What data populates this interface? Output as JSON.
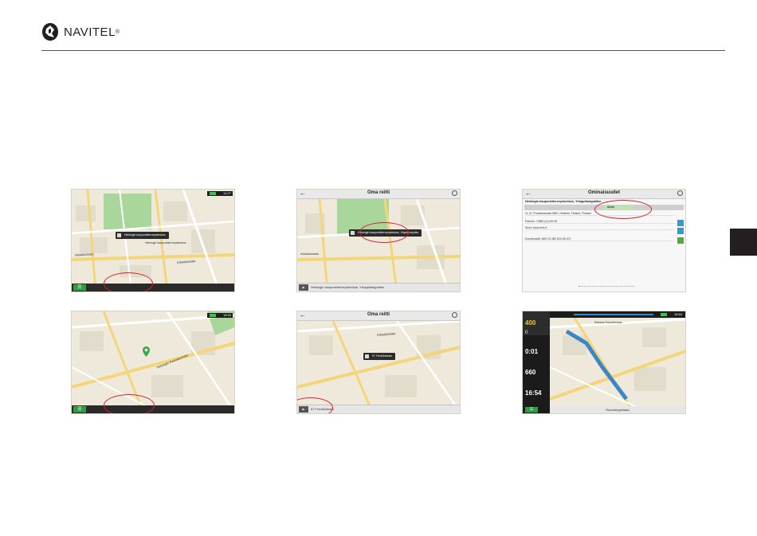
{
  "brand": {
    "name": "NAVITEL",
    "reg": "®"
  },
  "shots": {
    "s1": {
      "time": "14:27",
      "popup": "Helsingin kaupunkiterveyskeskus",
      "label_a": "Helsingin kaupunkiterveyskeskus",
      "street1": "Arkadiankatu",
      "street2": "Arkadiankatu"
    },
    "s2": {
      "title": "Oma reitti",
      "popup": "Helsingin kaupunkiterveyskeskus, Vlopistonpolku",
      "route": "Helsingin kaupunkiterveyskeskus, Ylioppilastypäiten",
      "street1": "Arkadiankatu"
    },
    "s3": {
      "title": "Ominaisuudet",
      "header": "Helsingin kaupunkiterveyskeskus, Ylioppilastypäiten",
      "go": "Aloita",
      "row1": "11 10, Pursilantaraita 0810, Helsinki, Finland, Finland",
      "row2": "Puhelin: +3580 (0) 000 00",
      "row3": "Sivut: www.hels.fi",
      "row4": "Koordinaatit: N60 10.380  E24 55.471"
    },
    "s4": {
      "time": "16:53",
      "street1": "Helsingin Rautatienkatu"
    },
    "s5": {
      "title": "Oma reitti",
      "popup": "57 Fredrikinkatu",
      "route": "57 Fredrikinkatu",
      "street1": "Arkadiankatu"
    },
    "s6": {
      "time": "16:54",
      "d1": "400",
      "d1u": "m",
      "d2": "0",
      "t1": "0:01",
      "d3": "660",
      "t2": "16:54",
      "street1": "Runebergintaatu",
      "street2": "Etelaine Rautatienkatu"
    }
  }
}
